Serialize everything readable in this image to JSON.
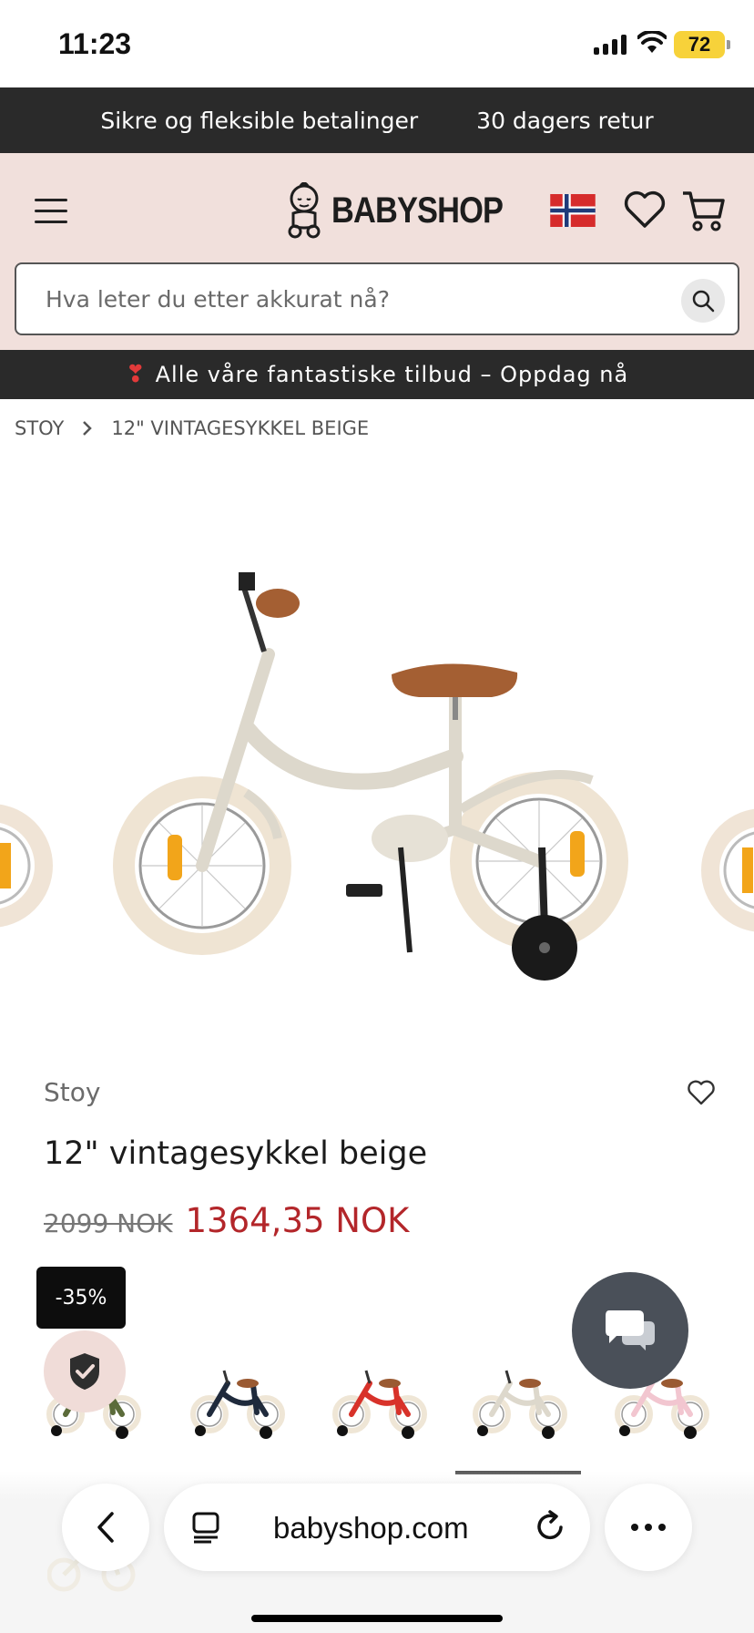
{
  "status_bar": {
    "time": "11:23",
    "battery": "72"
  },
  "info_bar": {
    "item1": "Sikre og fleksible betalinger",
    "item2": "30 dagers retur"
  },
  "header": {
    "logo": "BABYSHOP"
  },
  "search": {
    "placeholder": "Hva leter du etter akkurat nå?"
  },
  "promo": {
    "icon": "❣",
    "text": "Alle våre fantastiske tilbud – Oppdag nå"
  },
  "breadcrumb": {
    "items": [
      "STOY",
      "12\" VINTAGESYKKEL BEIGE"
    ]
  },
  "product": {
    "brand": "Stoy",
    "name": "12\" vintagesykkel beige",
    "old_price": "2099 NOK",
    "price": "1364,35 NOK",
    "discount": "-35%"
  },
  "variants": [
    {
      "color": "#5b6b3a",
      "wheel": "#efe6d6"
    },
    {
      "color": "#1f2a3c",
      "wheel": "#efe6d6"
    },
    {
      "color": "#d8322a",
      "wheel": "#efe6d6"
    },
    {
      "color": "#ddd8cc",
      "wheel": "#efe6d6"
    },
    {
      "color": "#f2c6d0",
      "wheel": "#efe6d6"
    }
  ],
  "browser": {
    "url": "babyshop.com"
  },
  "colors": {
    "header_bg": "#f1e0dc",
    "dark_bar": "#2a2a2a",
    "sale": "#b3262a"
  }
}
